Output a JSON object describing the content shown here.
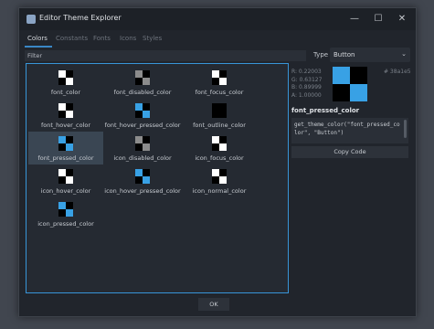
{
  "window": {
    "title": "Editor Theme Explorer",
    "controls": [
      "—",
      "☐",
      "✕"
    ]
  },
  "tabs": [
    "Colors",
    "Constants",
    "Fonts",
    "Icons",
    "Styles"
  ],
  "filter": {
    "label": "Filter"
  },
  "type": {
    "label": "Type",
    "value": "Button",
    "chevron": "⌄"
  },
  "grid": {
    "items": [
      {
        "label": "font_color",
        "pattern": "white"
      },
      {
        "label": "font_disabled_color",
        "pattern": "gray"
      },
      {
        "label": "font_focus_color",
        "pattern": "white"
      },
      {
        "label": "font_hover_color",
        "pattern": "white"
      },
      {
        "label": "font_hover_pressed_color",
        "pattern": "blue"
      },
      {
        "label": "font_outline_color",
        "pattern": "black"
      },
      {
        "label": "font_pressed_color",
        "pattern": "blue",
        "selected": true
      },
      {
        "label": "icon_disabled_color",
        "pattern": "gray"
      },
      {
        "label": "icon_focus_color",
        "pattern": "white"
      },
      {
        "label": "icon_hover_color",
        "pattern": "white"
      },
      {
        "label": "icon_hover_pressed_color",
        "pattern": "blue"
      },
      {
        "label": "icon_normal_color",
        "pattern": "white"
      },
      {
        "label": "icon_pressed_color",
        "pattern": "blue"
      }
    ]
  },
  "details": {
    "r": "R: 0.22003",
    "g": "G: 0.63127",
    "b": "B: 0.89999",
    "a": "A: 1.00000",
    "hex": "# 38a1e5",
    "selected_name": "font_pressed_color",
    "code": "get_theme_color(\"font_pressed_color\", \"Button\")",
    "copy_label": "Copy Code"
  },
  "footer": {
    "ok_label": "OK"
  },
  "colors": {
    "accent": "#3895d8",
    "swatch_blue": "#38a1e5",
    "swatch_gray": "#8c8c8c",
    "swatch_white": "#ffffff",
    "swatch_black": "#000000"
  }
}
